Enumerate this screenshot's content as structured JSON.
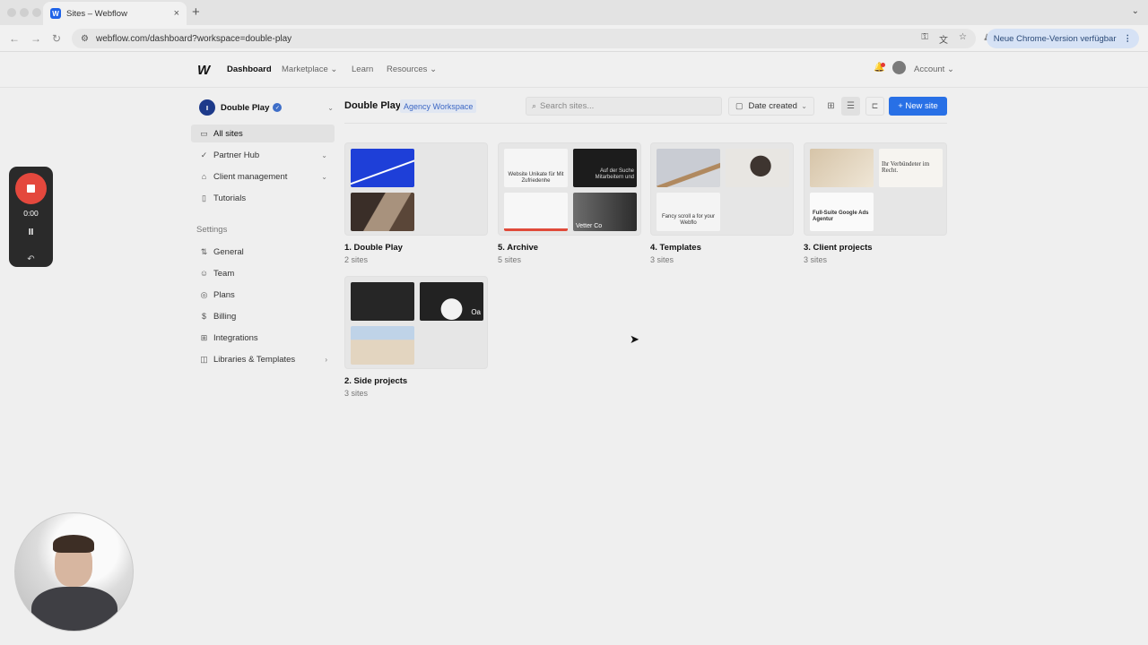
{
  "browser": {
    "tab_title": "Sites – Webflow",
    "tab_favicon": "W",
    "tab_close": "×",
    "new_tab": "+",
    "url": "webflow.com/dashboard?workspace=double-play",
    "update_label": "Neue Chrome-Version verfügbar",
    "menu_glyph": "⋮"
  },
  "header": {
    "logo": "W",
    "nav": [
      {
        "label": "Dashboard"
      },
      {
        "label": "Marketplace"
      },
      {
        "label": "Learn"
      },
      {
        "label": "Resources"
      }
    ],
    "account_label": "Account",
    "dropdown_glyph": "⌄"
  },
  "sidebar": {
    "workspace_initial": "ı",
    "workspace_name": "Double Play",
    "items": [
      {
        "label": "All sites",
        "icon": "folder-icon"
      },
      {
        "label": "Partner Hub",
        "icon": "badge-check-icon"
      },
      {
        "label": "Client management",
        "icon": "briefcase-icon"
      },
      {
        "label": "Tutorials",
        "icon": "book-icon"
      }
    ],
    "settings_heading": "Settings",
    "settings_items": [
      {
        "label": "General",
        "icon": "sliders-icon"
      },
      {
        "label": "Team",
        "icon": "users-icon"
      },
      {
        "label": "Plans",
        "icon": "plans-icon"
      },
      {
        "label": "Billing",
        "icon": "dollar-icon"
      },
      {
        "label": "Integrations",
        "icon": "grid-icon"
      },
      {
        "label": "Libraries & Templates",
        "icon": "library-icon"
      }
    ]
  },
  "main": {
    "title": "Double Play",
    "badge": "Agency Workspace",
    "search_placeholder": "Search sites...",
    "sort_label": "Date created",
    "new_site_label": "+ New site",
    "folders": [
      {
        "name": "1. Double Play",
        "count": "2 sites",
        "thumb_texts": [
          "",
          "",
          "",
          ""
        ]
      },
      {
        "name": "5. Archive",
        "count": "5 sites",
        "thumb_texts": [
          "Website Unikate für Mit Zufriedenhe",
          "Auf der Suche Mitarbeitern und",
          "",
          "Vetter Co"
        ]
      },
      {
        "name": "4. Templates",
        "count": "3 sites",
        "thumb_texts": [
          "",
          "",
          "Fancy scroll a for your Webflo",
          ""
        ]
      },
      {
        "name": "3. Client projects",
        "count": "3 sites",
        "thumb_texts": [
          "",
          "Ihr Verbündeter im Recht.",
          "Full-Suite Google Ads Agentur",
          ""
        ]
      },
      {
        "name": "2. Side projects",
        "count": "3 sites",
        "thumb_texts": [
          "",
          "Oa",
          "",
          ""
        ]
      }
    ]
  },
  "recorder": {
    "time": "0:00",
    "pause_glyph": "II",
    "undo_glyph": "↶"
  },
  "colors": {
    "accent": "#2870e6",
    "record": "#e4483d",
    "badge_text": "#3b67c4"
  }
}
